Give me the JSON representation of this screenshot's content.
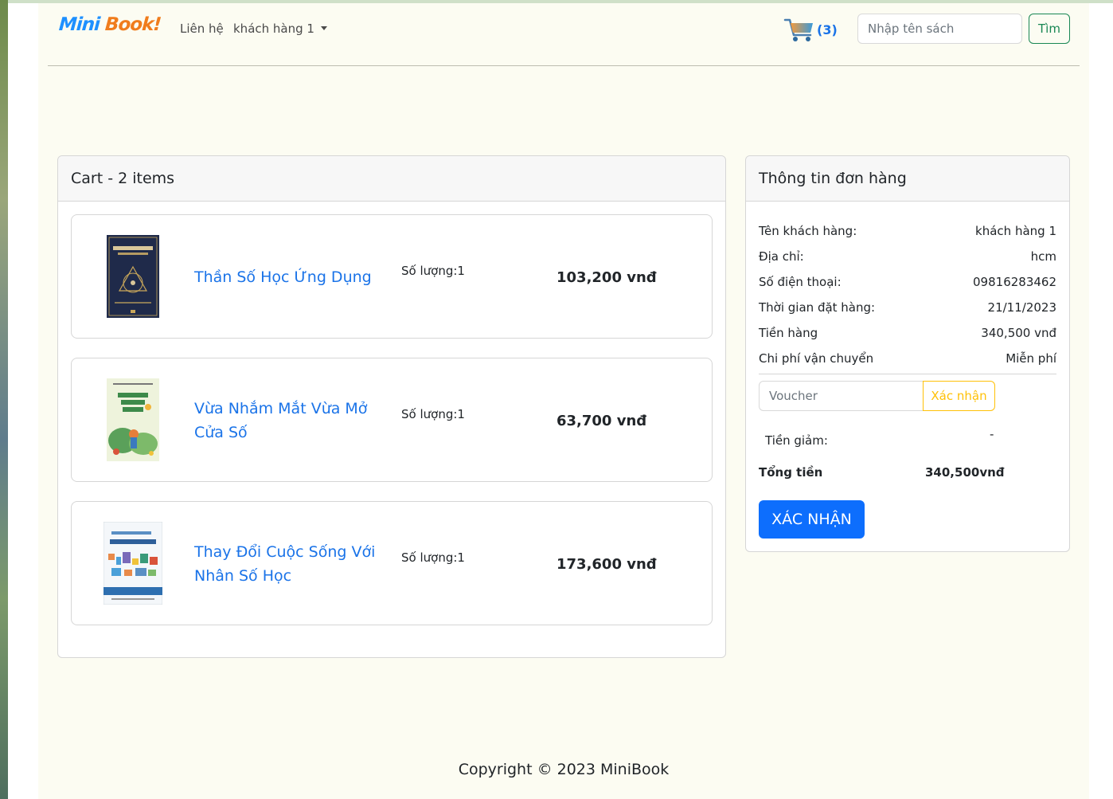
{
  "nav": {
    "brand_part1": "Mini",
    "brand_part2": "Book!",
    "contact": "Liên hệ",
    "user_menu": "khách hàng 1",
    "cart_count": "(3)",
    "search_placeholder": "Nhập tên sách",
    "search_button": "Tìm"
  },
  "cart": {
    "header": "Cart - 2 items",
    "items": [
      {
        "title": "Thần Số Học Ứng Dụng",
        "quantity": "Số lượng:1",
        "price": "103,200 vnđ",
        "cover_color": "#1f2a4a"
      },
      {
        "title": "Vừa Nhắm Mắt Vừa Mở Cửa Số",
        "quantity": "Số lượng:1",
        "price": "63,700 vnđ",
        "cover_color": "#e9efd7"
      },
      {
        "title": "Thay Đổi Cuộc Sống Với Nhân Số Học",
        "quantity": "Số lượng:1",
        "price": "173,600 vnđ",
        "cover_color": "#f2f6fa"
      }
    ]
  },
  "order": {
    "header": "Thông tin đơn hàng",
    "rows": [
      {
        "label": "Tên khách hàng:",
        "value": "khách hàng 1"
      },
      {
        "label": "Địa chỉ:",
        "value": "hcm"
      },
      {
        "label": "Số điện thoại:",
        "value": "09816283462"
      },
      {
        "label": "Thời gian đặt hàng:",
        "value": "21/11/2023"
      },
      {
        "label": "Tiền hàng",
        "value": "340,500 vnđ"
      },
      {
        "label": "Chi phí vận chuyển",
        "value": "Miễn phí"
      }
    ],
    "voucher_placeholder": "Voucher",
    "voucher_button": "Xác nhận",
    "discount_label": "Tiền giảm:",
    "discount_value": "-",
    "total_label": "Tổng tiền",
    "total_value": "340,500vnđ",
    "confirm_button": "XÁC NHẬN"
  },
  "footer": {
    "copyright": "Copyright © 2023 MiniBook"
  },
  "colors": {
    "page_bg": "#fcfcf2",
    "link": "#1a73e8",
    "primary": "#0d6efd",
    "success": "#198754",
    "warning": "#ffc107"
  }
}
